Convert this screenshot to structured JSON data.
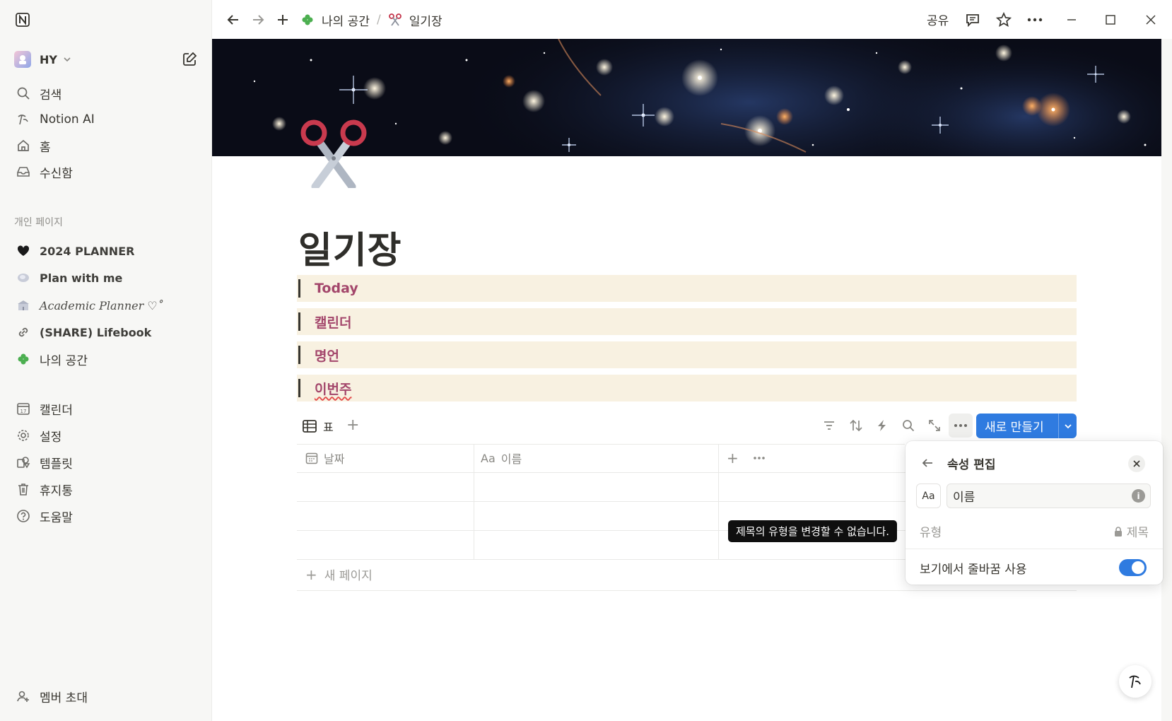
{
  "workspace": {
    "name": "HY"
  },
  "sidebar": {
    "top_items": [
      {
        "label": "검색",
        "icon": "search-icon"
      },
      {
        "label": "Notion AI",
        "icon": "notion-ai-icon"
      },
      {
        "label": "홈",
        "icon": "home-icon"
      },
      {
        "label": "수신함",
        "icon": "inbox-icon"
      }
    ],
    "section_label": "개인 페이지",
    "pages": [
      {
        "label": "2024 PLANNER",
        "icon": "black-heart-icon"
      },
      {
        "label": "Plan with me",
        "icon": "shell-icon"
      },
      {
        "label": "Academic Planner ♡˚",
        "icon": "school-icon"
      },
      {
        "label": "(SHARE) Lifebook",
        "icon": "link-icon"
      },
      {
        "label": "나의 공간",
        "icon": "clover-icon"
      }
    ],
    "tools": [
      {
        "label": "캘린더",
        "icon": "calendar-icon",
        "icon_text": "17"
      },
      {
        "label": "설정",
        "icon": "gear-icon"
      },
      {
        "label": "템플릿",
        "icon": "template-icon"
      },
      {
        "label": "휴지통",
        "icon": "trash-icon"
      },
      {
        "label": "도움말",
        "icon": "help-icon"
      }
    ],
    "invite": {
      "label": "멤버 초대",
      "icon": "add-member-icon"
    }
  },
  "topbar": {
    "breadcrumb": [
      {
        "label": "나의 공간",
        "icon": "clover-icon"
      },
      {
        "label": "일기장",
        "icon": "scissors-icon"
      }
    ],
    "breadcrumb_sep": "/",
    "share_label": "공유"
  },
  "page": {
    "title": "일기장",
    "callouts": [
      "Today",
      "캘린더",
      "명언",
      "이번주"
    ]
  },
  "database": {
    "view_label": "표",
    "new_button_label": "새로 만들기",
    "columns": [
      {
        "label": "날짜",
        "icon": "calendar-prop-icon"
      },
      {
        "label": "이름",
        "icon_text": "Aa"
      }
    ],
    "new_page_label": "새 페이지"
  },
  "tooltip": {
    "text": "제목의 유형을 변경할 수 없습니다."
  },
  "property_popover": {
    "title": "속성 편집",
    "type_icon_text": "Aa",
    "name_value": "이름",
    "type_label": "유형",
    "type_value": "제목",
    "wrap_label": "보기에서 줄바꿈 사용",
    "wrap_enabled": true
  },
  "colors": {
    "accent": "#2f7be0",
    "callout_bg": "#f8f1e1",
    "callout_text": "#a3466b",
    "sidebar_bg": "#f7f7f5"
  }
}
